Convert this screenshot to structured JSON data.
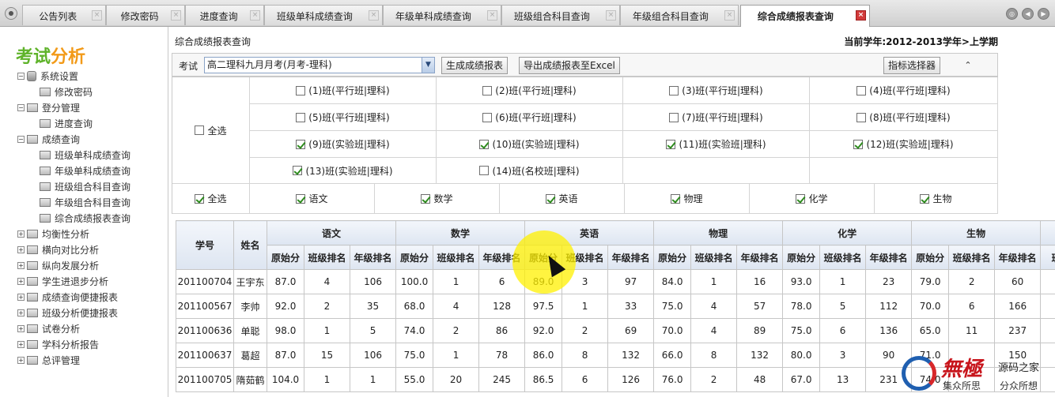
{
  "tabs": [
    {
      "label": "公告列表"
    },
    {
      "label": "修改密码"
    },
    {
      "label": "进度查询"
    },
    {
      "label": "班级单科成绩查询"
    },
    {
      "label": "年级单科成绩查询"
    },
    {
      "label": "班级组合科目查询"
    },
    {
      "label": "年级组合科目查询"
    },
    {
      "label": "综合成绩报表查询",
      "active": true
    }
  ],
  "sidebar": {
    "logo_part1": "考试",
    "logo_part2": "分析",
    "items": [
      {
        "label": "系统设置",
        "level": 0,
        "expanded": true
      },
      {
        "label": "修改密码",
        "level": 1
      },
      {
        "label": "登分管理",
        "level": 0,
        "expanded": true
      },
      {
        "label": "进度查询",
        "level": 1
      },
      {
        "label": "成绩查询",
        "level": 0,
        "expanded": true
      },
      {
        "label": "班级单科成绩查询",
        "level": 1
      },
      {
        "label": "年级单科成绩查询",
        "level": 1
      },
      {
        "label": "班级组合科目查询",
        "level": 1
      },
      {
        "label": "年级组合科目查询",
        "level": 1
      },
      {
        "label": "综合成绩报表查询",
        "level": 1
      },
      {
        "label": "均衡性分析",
        "level": 0,
        "expanded": false
      },
      {
        "label": "横向对比分析",
        "level": 0,
        "expanded": false
      },
      {
        "label": "纵向发展分析",
        "level": 0,
        "expanded": false
      },
      {
        "label": "学生进退步分析",
        "level": 0,
        "expanded": false
      },
      {
        "label": "成绩查询便捷报表",
        "level": 0,
        "expanded": false
      },
      {
        "label": "班级分析便捷报表",
        "level": 0,
        "expanded": false
      },
      {
        "label": "试卷分析",
        "level": 0,
        "expanded": false
      },
      {
        "label": "学科分析报告",
        "level": 0,
        "expanded": false
      },
      {
        "label": "总评管理",
        "level": 0,
        "expanded": false
      }
    ]
  },
  "breadcrumb": "综合成绩报表查询",
  "term_info": "当前学年:2012-2013学年>上学期",
  "toolbar": {
    "exam_label": "考试",
    "exam_value": "高二理科九月月考(月考-理科)",
    "generate_label": "生成成绩报表",
    "export_label": "导出成绩报表至Excel",
    "indicator_label": "指标选择器",
    "collapse_glyph": "⌃"
  },
  "filter": {
    "select_all_label": "全选",
    "select_all_checked": false,
    "classes": [
      {
        "label": "(1)班(平行班|理科)",
        "checked": false
      },
      {
        "label": "(2)班(平行班|理科)",
        "checked": false
      },
      {
        "label": "(3)班(平行班|理科)",
        "checked": false
      },
      {
        "label": "(4)班(平行班|理科)",
        "checked": false
      },
      {
        "label": "(5)班(平行班|理科)",
        "checked": false
      },
      {
        "label": "(6)班(平行班|理科)",
        "checked": false
      },
      {
        "label": "(7)班(平行班|理科)",
        "checked": false
      },
      {
        "label": "(8)班(平行班|理科)",
        "checked": false
      },
      {
        "label": "(9)班(实验班|理科)",
        "checked": true
      },
      {
        "label": "(10)班(实验班|理科)",
        "checked": true
      },
      {
        "label": "(11)班(实验班|理科)",
        "checked": true
      },
      {
        "label": "(12)班(实验班|理科)",
        "checked": true
      },
      {
        "label": "(13)班(实验班|理科)",
        "checked": true
      },
      {
        "label": "(14)班(名校班|理科)",
        "checked": false
      }
    ],
    "subject_select_all_label": "全选",
    "subject_select_all_checked": true,
    "subjects": [
      {
        "label": "语文",
        "checked": true
      },
      {
        "label": "数学",
        "checked": true
      },
      {
        "label": "英语",
        "checked": true
      },
      {
        "label": "物理",
        "checked": true
      },
      {
        "label": "化学",
        "checked": true
      },
      {
        "label": "生物",
        "checked": true
      }
    ]
  },
  "table": {
    "id_header": "学号",
    "name_header": "姓名",
    "subjects": [
      "语文",
      "数学",
      "英语",
      "物理",
      "化学",
      "生物"
    ],
    "sub_headers": [
      "原始分",
      "班级排名",
      "年级排名"
    ],
    "next_subject_partial": "班",
    "rows": [
      {
        "id": "201100704",
        "name": "王宇东",
        "scores": [
          [
            "87.0",
            "4",
            "106"
          ],
          [
            "100.0",
            "1",
            "6"
          ],
          [
            "89.0",
            "3",
            "97"
          ],
          [
            "84.0",
            "1",
            "16"
          ],
          [
            "93.0",
            "1",
            "23"
          ],
          [
            "79.0",
            "2",
            "60"
          ]
        ]
      },
      {
        "id": "201100567",
        "name": "李帅",
        "scores": [
          [
            "92.0",
            "2",
            "35"
          ],
          [
            "68.0",
            "4",
            "128"
          ],
          [
            "97.5",
            "1",
            "33"
          ],
          [
            "75.0",
            "4",
            "57"
          ],
          [
            "78.0",
            "5",
            "112"
          ],
          [
            "70.0",
            "6",
            "166"
          ]
        ]
      },
      {
        "id": "201100636",
        "name": "单聪",
        "scores": [
          [
            "98.0",
            "1",
            "5"
          ],
          [
            "74.0",
            "2",
            "86"
          ],
          [
            "92.0",
            "2",
            "69"
          ],
          [
            "70.0",
            "4",
            "89"
          ],
          [
            "75.0",
            "6",
            "136"
          ],
          [
            "65.0",
            "11",
            "237"
          ]
        ]
      },
      {
        "id": "201100637",
        "name": "葛超",
        "scores": [
          [
            "87.0",
            "15",
            "106"
          ],
          [
            "75.0",
            "1",
            "78"
          ],
          [
            "86.0",
            "8",
            "132"
          ],
          [
            "66.0",
            "8",
            "132"
          ],
          [
            "80.0",
            "3",
            "90"
          ],
          [
            "71.0",
            "",
            "150"
          ]
        ]
      },
      {
        "id": "201100705",
        "name": "隋茹鹤",
        "scores": [
          [
            "104.0",
            "1",
            "1"
          ],
          [
            "55.0",
            "20",
            "245"
          ],
          [
            "86.5",
            "6",
            "126"
          ],
          [
            "76.0",
            "2",
            "48"
          ],
          [
            "67.0",
            "13",
            "231"
          ],
          [
            "74.0",
            "",
            ""
          ]
        ]
      }
    ]
  },
  "watermark": {
    "big": "無極",
    "t1": "源码之家",
    "t2": "集众所思",
    "t3": "分众所想"
  },
  "colors": {
    "logo_green": "#5fb32a",
    "logo_orange": "#f29a18",
    "active_close": "#d23a3a",
    "check_green": "#2e8b1e",
    "header_blue": "#dde5f1"
  }
}
